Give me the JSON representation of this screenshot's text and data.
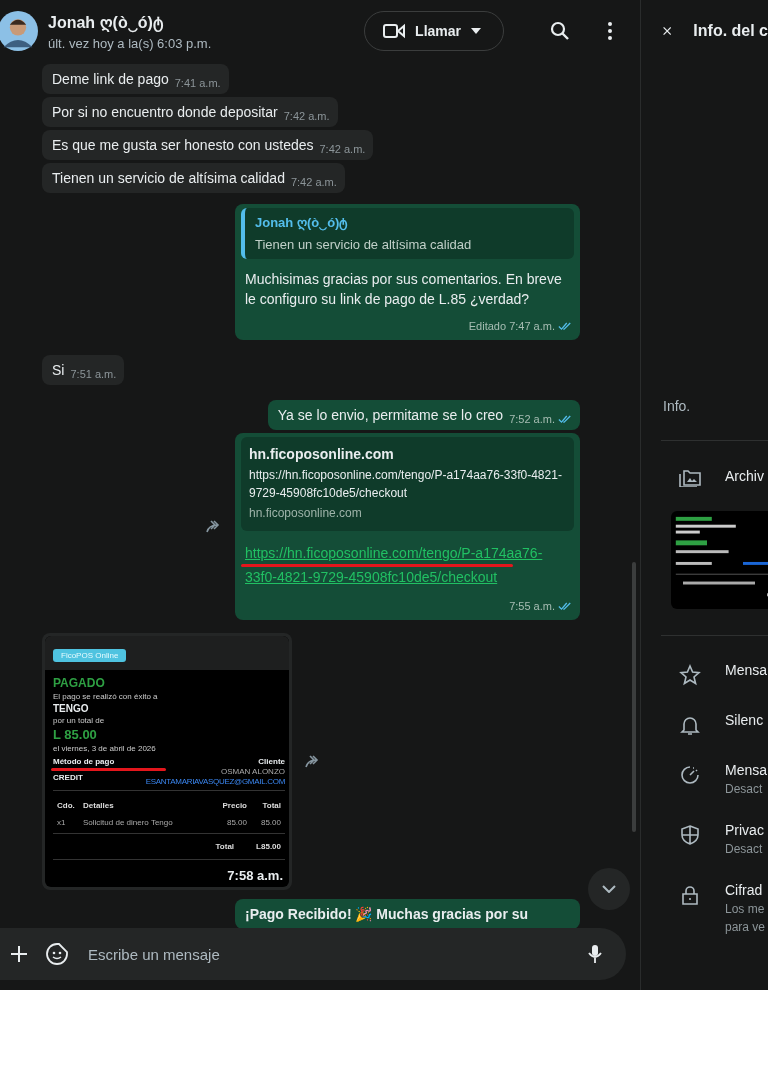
{
  "header": {
    "name": "Jonah ღ(ò‿ó)ტ",
    "status": "últ. vez hoy a la(s) 6:03 p.m.",
    "call_label": "Llamar"
  },
  "messages": [
    {
      "kind": "text",
      "sent": false,
      "text": "Deme link de pago",
      "time": "7:41 a.m."
    },
    {
      "kind": "text",
      "sent": false,
      "text": "Por si no encuentro donde depositar",
      "time": "7:42 a.m."
    },
    {
      "kind": "text",
      "sent": false,
      "text": "Es que me gusta ser honesto con ustedes",
      "time": "7:42 a.m."
    },
    {
      "kind": "text",
      "sent": false,
      "text": "Tienen un servicio de altísima calidad",
      "time": "7:42 a.m."
    },
    {
      "kind": "reply",
      "sent": true,
      "quote": {
        "author": "Jonah ღ(ò‿ó)ტ",
        "text": "Tienen un servicio de altísima calidad"
      },
      "text": "Muchisimas gracias por sus comentarios. En breve le configuro su link de pago de L.85 ¿verdad?",
      "edited_label": "Editado",
      "time": "7:47 a.m.",
      "read": true
    },
    {
      "kind": "text",
      "sent": false,
      "text": "Si",
      "time": "7:51 a.m."
    },
    {
      "kind": "text",
      "sent": true,
      "text": "Ya se lo envio, permitame se lo creo",
      "time": "7:52 a.m.",
      "read": true
    },
    {
      "kind": "link",
      "sent": true,
      "forward": true,
      "preview": {
        "title": "hn.ficoposonline.com",
        "url": "https://hn.ficoposonline.com/tengo/P-a174aa76-33f0-4821-9729-45908fc10de5/checkout",
        "domain": "hn.ficoposonline.com"
      },
      "link": "https://hn.ficoposonline.com/tengo/P-a174aa76-33f0-4821-9729-45908fc10de5/checkout",
      "time": "7:55 a.m.",
      "read": true
    },
    {
      "sent": false,
      "forward": true,
      "time": "7:58 a.m.",
      "receipt": {
        "badge": "FicoPOS Online",
        "status": "PAGADO",
        "intro": "El pago se realizó con éxito a",
        "merchant": "TENGO",
        "total_intro": "por un total de",
        "amount": "L 85.00",
        "date": "el viernes, 3 de abril de 2026",
        "method_label": "Método de pago",
        "method": "CREDIT",
        "client_label": "Cliente",
        "client_name": "OSMAN ALONZO",
        "client_email": "ESANTAMARIAVASQUEZ@GMAIL.COM",
        "columns": [
          "Cdo.",
          "Detalles",
          "Precio",
          "Total"
        ],
        "row": [
          "x1",
          "Solicitud de dinero Tengo",
          "85.00",
          "85.00"
        ],
        "total_label": "Total",
        "total": "L85.00"
      }
    },
    {
      "kind": "text",
      "sent": true,
      "text": "¡Pago Recibido! 🎉 Muchas gracias por su"
    }
  ],
  "composer": {
    "placeholder": "Escribe un mensaje"
  },
  "info_panel": {
    "title": "Info. del c",
    "section_label": "Info.",
    "media_label": "Archiv",
    "items": [
      {
        "kind": "star",
        "title": "Mensa"
      },
      {
        "kind": "bell",
        "title": "Silenc"
      },
      {
        "kind": "timer",
        "title": "Mensa",
        "subtitle": "Desact"
      },
      {
        "kind": "shield",
        "title": "Privac",
        "subtitle": "Desact"
      },
      {
        "kind": "lock",
        "title": "Cifrad",
        "subtitle": "Los me",
        "subtitle2": "para ve"
      }
    ]
  }
}
